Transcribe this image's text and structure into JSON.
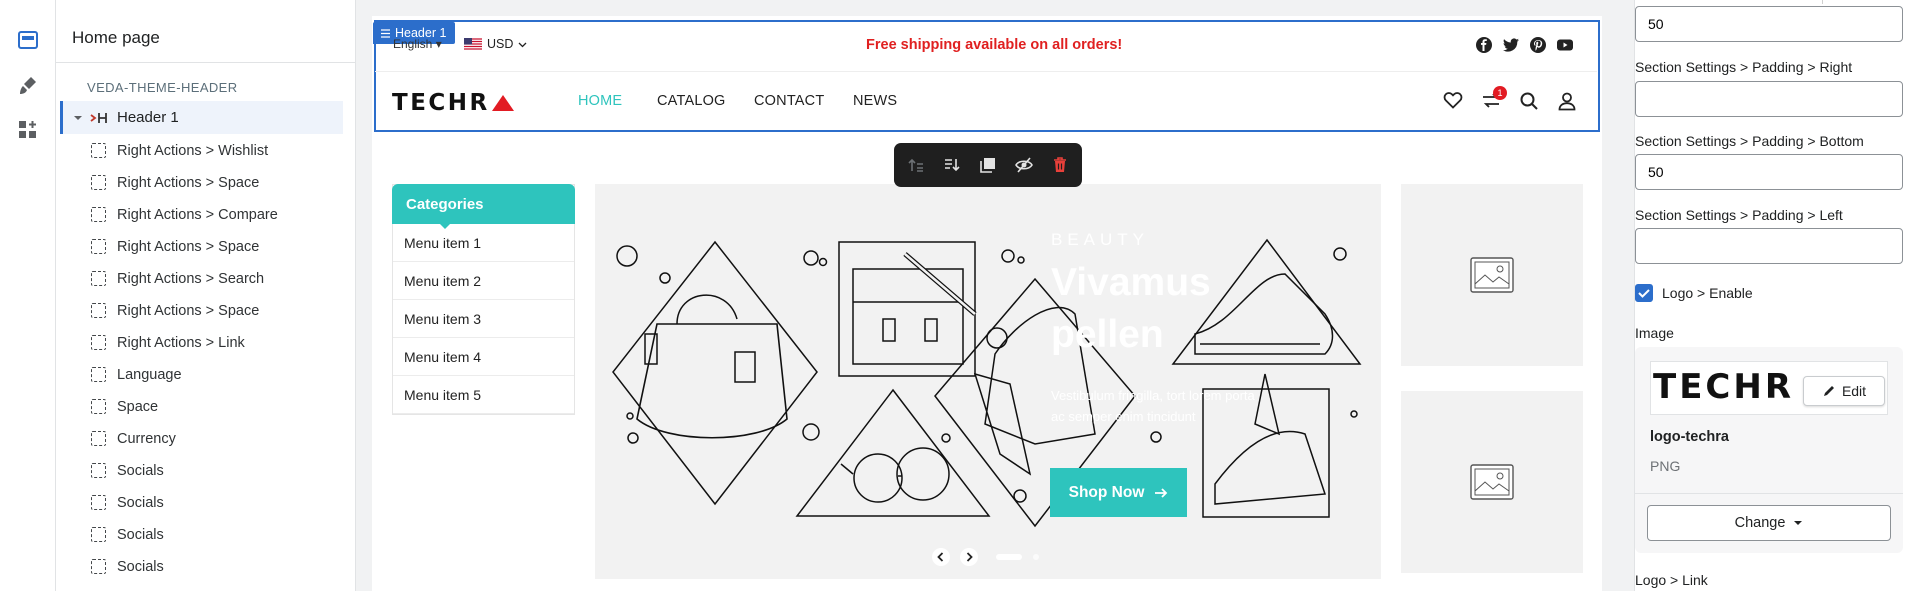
{
  "tree": {
    "title": "Home page",
    "group": "VEDA-THEME-HEADER",
    "node_label": "Header 1",
    "items": [
      "Right Actions > Wishlist",
      "Right Actions > Space",
      "Right Actions > Compare",
      "Right Actions > Space",
      "Right Actions > Search",
      "Right Actions > Space",
      "Right Actions > Link",
      "Language",
      "Space",
      "Currency",
      "Socials",
      "Socials",
      "Socials",
      "Socials"
    ]
  },
  "preview": {
    "header_tag": "Header 1",
    "language": "English",
    "currency": "USD",
    "announcement": "Free shipping available on all orders!",
    "logo": "TECHR",
    "nav": [
      "HOME",
      "CATALOG",
      "CONTACT",
      "NEWS"
    ],
    "cart_count": "1",
    "categories": {
      "title": "Categories",
      "items": [
        "Menu item 1",
        "Menu item 2",
        "Menu item 3",
        "Menu item 4",
        "Menu item 5"
      ]
    },
    "hero": {
      "eyebrow": "BEAUTY",
      "title_line1": "Vivamus",
      "title_line2": "pellen",
      "body_line1": "Vestibulum fringilla, tort lorem porta",
      "body_line2": "ac semper enim tincidunt",
      "cta": "Shop Now"
    }
  },
  "settings": {
    "padding_top_value": "50",
    "padding_right_label": "Section Settings > Padding > Right",
    "padding_right_value": "",
    "padding_bottom_label": "Section Settings > Padding > Bottom",
    "padding_bottom_value": "50",
    "padding_left_label": "Section Settings > Padding > Left",
    "padding_left_value": "",
    "logo_enable_label": "Logo > Enable",
    "logo_enable_checked": true,
    "image_label": "Image",
    "image_name": "logo-techra",
    "image_type": "PNG",
    "edit_label": "Edit",
    "change_label": "Change",
    "logo_link_label": "Logo > Link"
  },
  "colors": {
    "accent": "#2c6ecb",
    "brand_teal": "#2ec4bd",
    "announcement": "#e02020",
    "logo_red": "#e21b23"
  }
}
